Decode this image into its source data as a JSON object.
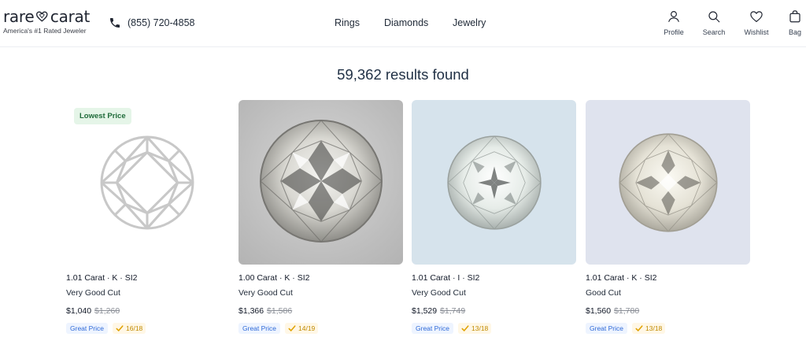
{
  "brand": {
    "name_left": "rare",
    "name_right": "carat",
    "tagline": "America's #1 Rated Jeweler",
    "heart_icon": "heart-diamond-icon"
  },
  "header": {
    "phone_icon": "phone-icon",
    "phone": "(855) 720-4858",
    "nav": [
      "Rings",
      "Diamonds",
      "Jewelry"
    ],
    "utilities": [
      {
        "label": "Profile",
        "icon": "user-icon"
      },
      {
        "label": "Search",
        "icon": "search-icon"
      },
      {
        "label": "Wishlist",
        "icon": "heart-icon"
      },
      {
        "label": "Bag",
        "icon": "bag-icon"
      }
    ]
  },
  "results": {
    "text": "59,362 results found"
  },
  "products": [
    {
      "badge": "Lowest Price",
      "spec": "1.01 Carat · K · SI2",
      "cut": "Very Good Cut",
      "price": "$1,040",
      "old_price": "$1,260",
      "tag": "Great Price",
      "score": "16/18",
      "image": "diamond-outline-placeholder"
    },
    {
      "badge": "",
      "spec": "1.00 Carat · K · SI2",
      "cut": "Very Good Cut",
      "price": "$1,366",
      "old_price": "$1,586",
      "tag": "Great Price",
      "score": "14/19",
      "image": "diamond-photo"
    },
    {
      "badge": "",
      "spec": "1.01 Carat · I · SI2",
      "cut": "Very Good Cut",
      "price": "$1,529",
      "old_price": "$1,749",
      "tag": "Great Price",
      "score": "13/18",
      "image": "diamond-photo"
    },
    {
      "badge": "",
      "spec": "1.01 Carat · K · SI2",
      "cut": "Good Cut",
      "price": "$1,560",
      "old_price": "$1,780",
      "tag": "Great Price",
      "score": "13/18",
      "image": "diamond-photo"
    }
  ],
  "colors": {
    "great_price_bg": "#eef4ff",
    "great_price_text": "#2f6ad8",
    "score_text": "#c08a00",
    "badge_bg": "#e5f5e8",
    "badge_text": "#1f6b3a"
  }
}
